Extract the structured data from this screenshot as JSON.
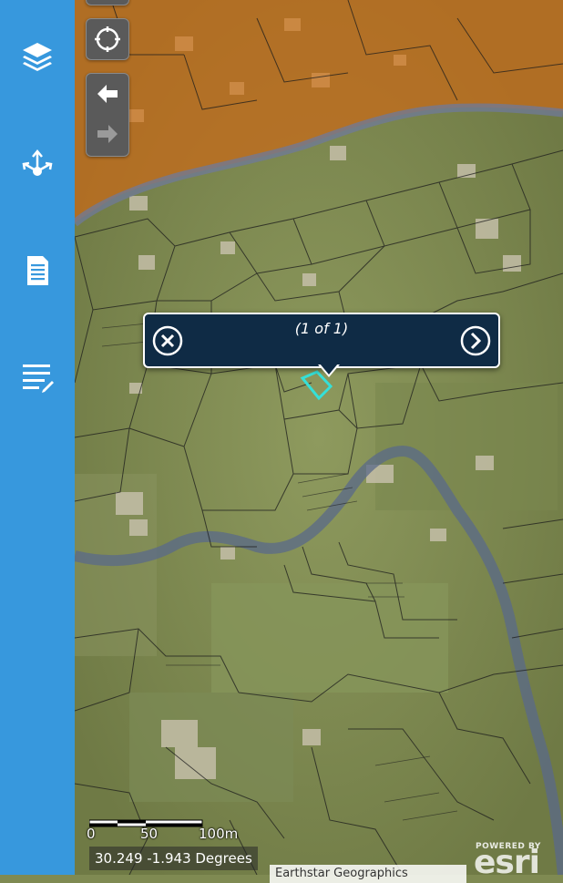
{
  "sidebar": {
    "items": [
      {
        "icon": "layers-icon",
        "label": "Layers"
      },
      {
        "icon": "share-network-icon",
        "label": "Share"
      },
      {
        "icon": "document-icon",
        "label": "Details"
      },
      {
        "icon": "edit-list-icon",
        "label": "Edit"
      }
    ]
  },
  "map_controls": {
    "locate_icon": "crosshair-icon",
    "back_icon": "arrow-left-icon",
    "forward_icon": "arrow-right-icon"
  },
  "popup": {
    "title": "(1 of 1)",
    "close_icon": "close-icon",
    "next_icon": "chevron-right-icon"
  },
  "scale": {
    "labels": [
      "0",
      "50",
      "100m"
    ]
  },
  "coordinates": "30.249 -1.943 Degrees",
  "attribution": "Earthstar Geographics",
  "esri_logo": {
    "powered_by": "POWERED BY",
    "name": "esri"
  },
  "colors": {
    "sidebar": "#3798dd",
    "popup_bg": "#0f2b45",
    "highlight": "#35e0d8",
    "overlay_orange": "#c96a18",
    "river": "#5a6a8a"
  }
}
